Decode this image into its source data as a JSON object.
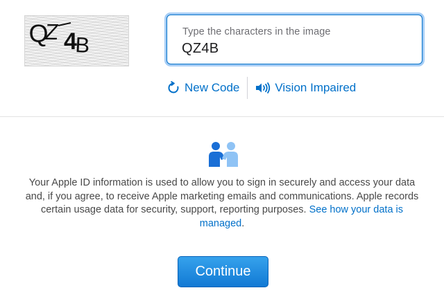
{
  "captcha": {
    "image_text": "QZ4B"
  },
  "field": {
    "label": "Type the characters in the image",
    "value": "QZ4B"
  },
  "actions": {
    "new_code": "New Code",
    "new_code_icon": "refresh-icon",
    "vision_impaired": "Vision Impaired",
    "vision_impaired_icon": "speaker-icon"
  },
  "privacy": {
    "icon": "people-handshake-icon",
    "text": "Your Apple ID information is used to allow you to sign in securely and access your data and, if you agree, to receive Apple marketing emails and communications. Apple records certain usage data for security, support, reporting purposes.",
    "link": "See how your data is managed",
    "link_suffix": "."
  },
  "continue_button": {
    "label": "Continue"
  },
  "colors": {
    "link": "#0070c9",
    "button_top": "#36a2ec",
    "button_bottom": "#1179d4",
    "focus_ring": "#0071e3",
    "icon_dark": "#1a6fd6",
    "icon_light": "#8fc3f5"
  }
}
